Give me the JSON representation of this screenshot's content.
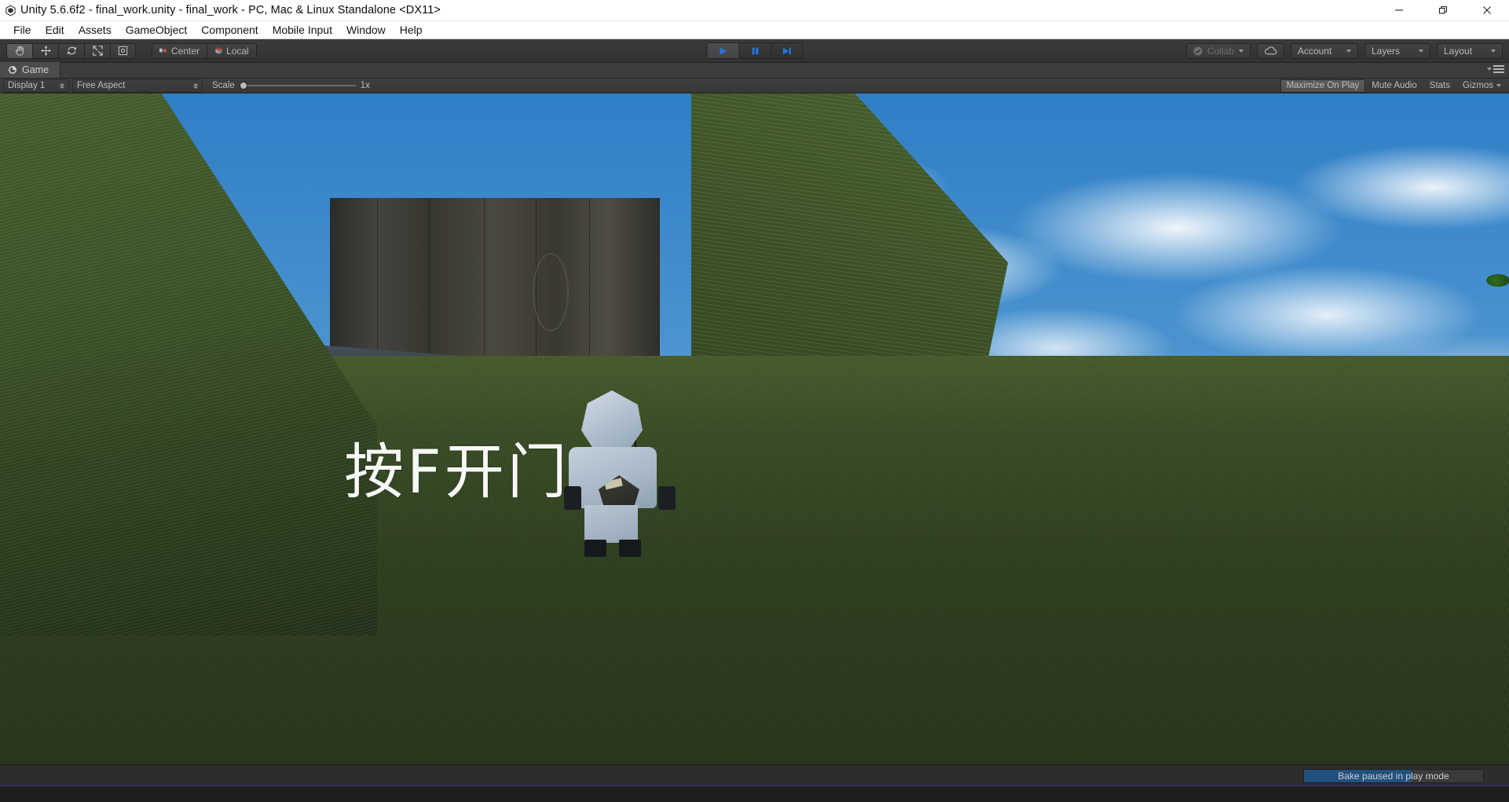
{
  "window": {
    "title": "Unity 5.6.6f2 - final_work.unity - final_work - PC, Mac & Linux Standalone <DX11>",
    "app_icon": "unity-logo-icon",
    "minimize_label": "—",
    "restore_label": "restore-icon",
    "close_label": "✕"
  },
  "menubar": {
    "items": [
      {
        "label": "File"
      },
      {
        "label": "Edit"
      },
      {
        "label": "Assets"
      },
      {
        "label": "GameObject"
      },
      {
        "label": "Component"
      },
      {
        "label": "Mobile Input"
      },
      {
        "label": "Window"
      },
      {
        "label": "Help"
      }
    ]
  },
  "toolbar": {
    "tools": [
      {
        "name": "hand-tool",
        "active": true
      },
      {
        "name": "move-tool",
        "active": false
      },
      {
        "name": "rotate-tool",
        "active": false
      },
      {
        "name": "scale-tool",
        "active": false
      },
      {
        "name": "rect-tool",
        "active": false
      }
    ],
    "pivot_mode": "Center",
    "pivot_rotation": "Local",
    "play_label": "play-icon",
    "pause_label": "pause-icon",
    "step_label": "step-icon",
    "play_active": true,
    "collab_label": "Collab",
    "cloud_label": "cloud-icon",
    "account_label": "Account",
    "layers_label": "Layers",
    "layout_label": "Layout"
  },
  "panel": {
    "tab_label": "Game",
    "tab_icon": "game-view-icon",
    "options_icon": "panel-options-icon",
    "display": "Display 1",
    "aspect": "Free Aspect",
    "scale_label": "Scale",
    "scale_value": "1x",
    "maximize_on_play": "Maximize On Play",
    "mute_audio": "Mute Audio",
    "stats": "Stats",
    "gizmos": "Gizmos",
    "maximize_active": true
  },
  "game": {
    "prompt_text": "按F开门",
    "scene_description": "low-poly medieval village behind a large wooden gate",
    "character_name": "player-character"
  },
  "status": {
    "bake_text": "Bake paused in play mode",
    "bake_progress": 60
  },
  "colors": {
    "accent_blue": "#22507f",
    "play_blue": "#1e7ae0",
    "toolbar_bg": "#383838",
    "panel_bg": "#3c3c3c",
    "titlebar_bg": "#ffffff"
  }
}
